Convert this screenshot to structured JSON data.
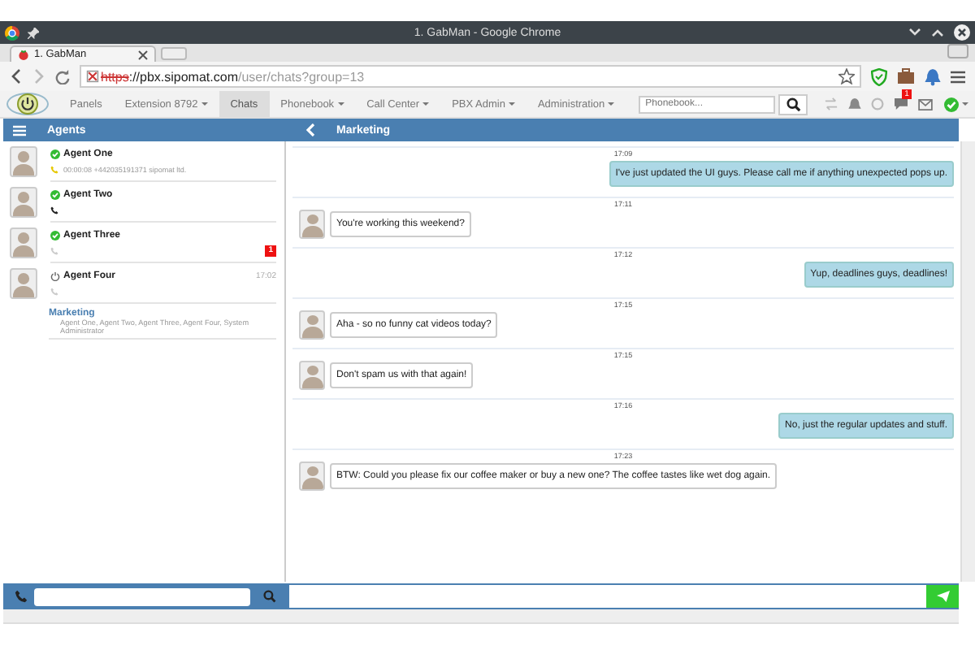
{
  "browser": {
    "title": "1. GabMan - Google Chrome",
    "tab": "1. GabMan",
    "url": [
      {
        "text": "https",
        "kind": "insecure"
      },
      {
        "text": "://pbx.sipomat.com",
        "kind": "host"
      },
      {
        "text": "/user/chats?group=13",
        "kind": "path"
      }
    ]
  },
  "nav": {
    "items": [
      {
        "label": "Panels",
        "dropdown": false,
        "selected": false
      },
      {
        "label": "Extension 8792",
        "dropdown": true,
        "selected": false
      },
      {
        "label": "Chats",
        "dropdown": false,
        "selected": true
      },
      {
        "label": "Phonebook",
        "dropdown": true,
        "selected": false
      },
      {
        "label": "Call Center",
        "dropdown": true,
        "selected": false
      },
      {
        "label": "PBX Admin",
        "dropdown": true,
        "selected": false
      },
      {
        "label": "Administration",
        "dropdown": true,
        "selected": false
      }
    ],
    "search": {
      "placeholder": "Phonebook..."
    },
    "chat_badge": "1"
  },
  "agents_header": "Agents",
  "chat_header": "Marketing",
  "agents": [
    {
      "name": "Agent One",
      "online": true,
      "on_call": true,
      "ringing": true,
      "detail": "00:00:08 +442035191371 sipomat ltd."
    },
    {
      "name": "Agent Two",
      "online": true,
      "on_call": true,
      "ringing": false
    },
    {
      "name": "Agent Three",
      "online": true,
      "on_call": false,
      "ringing": false,
      "badge": "1"
    },
    {
      "name": "Agent Four",
      "online": false,
      "on_call": false,
      "ringing": false,
      "time": "17:02"
    }
  ],
  "group": {
    "name": "Marketing",
    "members": "Agent One, Agent Two, Agent Three, Agent Four, System Administrator"
  },
  "messages": [
    {
      "time": "17:09",
      "outgoing": true,
      "text": "I've just updated the UI guys. Please call me if anything unexpected pops up."
    },
    {
      "time": "17:11",
      "outgoing": false,
      "text": "You're working this weekend?"
    },
    {
      "time": "17:12",
      "outgoing": true,
      "text": "Yup, deadlines guys, deadlines!"
    },
    {
      "time": "17:15",
      "outgoing": false,
      "text": "Aha - so no funny cat videos today?"
    },
    {
      "time": "17:15",
      "outgoing": false,
      "text": "Don't spam us with that again!"
    },
    {
      "time": "17:16",
      "outgoing": true,
      "text": "No, just the regular updates and stuff."
    },
    {
      "time": "17:23",
      "outgoing": false,
      "text": "BTW: Could you please fix our coffee maker or buy a new one? The coffee tastes like wet dog again."
    }
  ]
}
